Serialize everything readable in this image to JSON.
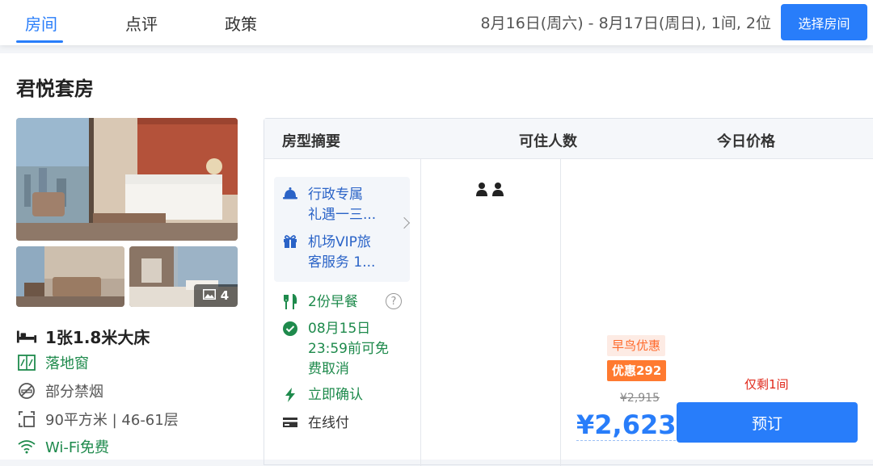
{
  "nav": {
    "tabs": [
      {
        "label": "房间",
        "active": true
      },
      {
        "label": "点评",
        "active": false
      },
      {
        "label": "政策",
        "active": false
      }
    ],
    "date_summary": "8月16日(周六) - 8月17日(周日), 1间, 2位",
    "select_room_label": "选择房间"
  },
  "room": {
    "title": "君悦套房",
    "photo_count": "4",
    "facts": {
      "bed": "1张1.8米大床",
      "window": "落地窗",
      "smoking": "部分禁烟",
      "area_floor": "90平方米 | 46-61层",
      "wifi": "Wi-Fi免费"
    }
  },
  "table": {
    "headers": {
      "summary": "房型摘要",
      "occupancy": "可住人数",
      "price": "今日价格"
    },
    "benefits": [
      {
        "line1": "行政专属",
        "line2": "礼遇一三...",
        "icon": "bell-icon"
      },
      {
        "line1": "机场VIP旅",
        "line2": "客服务 1...",
        "icon": "gift-icon"
      }
    ],
    "breakfast": "2份早餐",
    "cancel": [
      "08月15日",
      "23:59前可免",
      "费取消"
    ],
    "confirm": "立即确认",
    "payment": "在线付",
    "guests": 2,
    "offer": {
      "early_bird": "早鸟优惠",
      "discount": "优惠292",
      "original_price": "¥2,915",
      "price": "¥2,623",
      "rooms_left": "仅剩1间",
      "book_label": "预订"
    }
  },
  "colors": {
    "accent": "#287dfa",
    "green": "#1e8a4c",
    "orange": "#ff7a30",
    "red": "#e0281a"
  }
}
